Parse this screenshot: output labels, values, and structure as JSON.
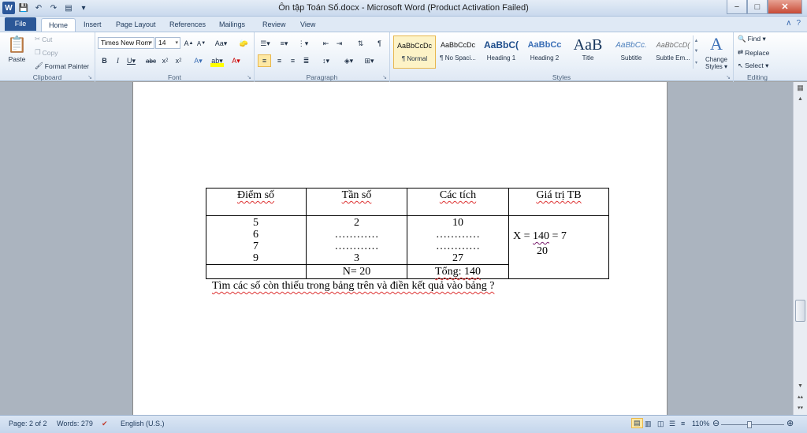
{
  "window": {
    "title": "Ôn tập Toán Số.docx  -  Microsoft Word (Product Activation Failed)",
    "controls": {
      "minimize": "−",
      "maximize": "□",
      "close": "✕"
    }
  },
  "quick_access": [
    "W",
    "💾",
    "↶",
    "↷",
    "▤",
    "▾"
  ],
  "tabs": [
    "File",
    "Home",
    "Insert",
    "Page Layout",
    "References",
    "Mailings",
    "Review",
    "View"
  ],
  "ribbon": {
    "clipboard": {
      "label": "Clipboard",
      "paste": "Paste",
      "cut": "Cut",
      "copy": "Copy",
      "format_painter": "Format Painter"
    },
    "font": {
      "label": "Font",
      "family": "Times New Rom",
      "size": "14"
    },
    "paragraph": {
      "label": "Paragraph"
    },
    "styles": {
      "label": "Styles",
      "items": [
        {
          "preview": "AaBbCcDc",
          "name": "¶ Normal"
        },
        {
          "preview": "AaBbCcDc",
          "name": "¶ No Spaci..."
        },
        {
          "preview": "AaBbC(",
          "name": "Heading 1"
        },
        {
          "preview": "AaBbCc",
          "name": "Heading 2"
        },
        {
          "preview": "AaB",
          "name": "Title"
        },
        {
          "preview": "AaBbCc.",
          "name": "Subtitle"
        },
        {
          "preview": "AaBbCcD(",
          "name": "Subtle Em..."
        }
      ],
      "change_styles": "Change Styles ▾"
    },
    "editing": {
      "label": "Editing",
      "find": "Find ▾",
      "replace": "Replace",
      "select": "Select ▾"
    }
  },
  "document": {
    "table": {
      "headers": [
        "Điểm số",
        "Tần số",
        "Các tích",
        "Giá trị TB"
      ],
      "col1": [
        "5",
        "6",
        "7",
        "9"
      ],
      "col2": [
        "2",
        "…………",
        "…………",
        "3"
      ],
      "col3": [
        "10",
        "…………",
        "…………",
        "27"
      ],
      "formula": {
        "lhs": "X = ",
        "numerator": "140",
        "rhs": " = 7",
        "denominator": "20"
      },
      "footer": [
        "",
        "N= 20",
        "Tổng: 140",
        ""
      ]
    },
    "instruction": "Tìm các số còn thiếu trong bảng trên và điền kết quả vào bảng ?"
  },
  "status": {
    "page": "Page: 2 of 2",
    "words": "Words: 279",
    "language": "English (U.S.)",
    "zoom": "110%",
    "zoom_level": 0.45
  }
}
